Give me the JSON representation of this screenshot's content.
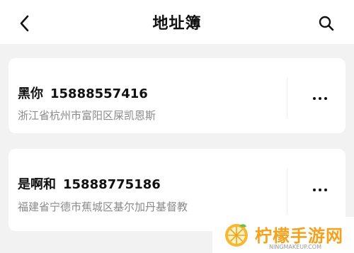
{
  "header": {
    "title": "地址簿",
    "back_icon": "chevron-left-icon",
    "search_icon": "search-icon"
  },
  "addresses": [
    {
      "name": "黑你",
      "phone": "15888557416",
      "address": "浙江省杭州市富阳区屎凯恩斯"
    },
    {
      "name": "是啊和",
      "phone": "15888775186",
      "address": "福建省宁德市蕉城区基尔加丹基督教"
    }
  ],
  "watermark": {
    "brand": "柠檬手游网",
    "url": "NINGMAKEUP.COM",
    "brand_color": "#f2a21c"
  }
}
